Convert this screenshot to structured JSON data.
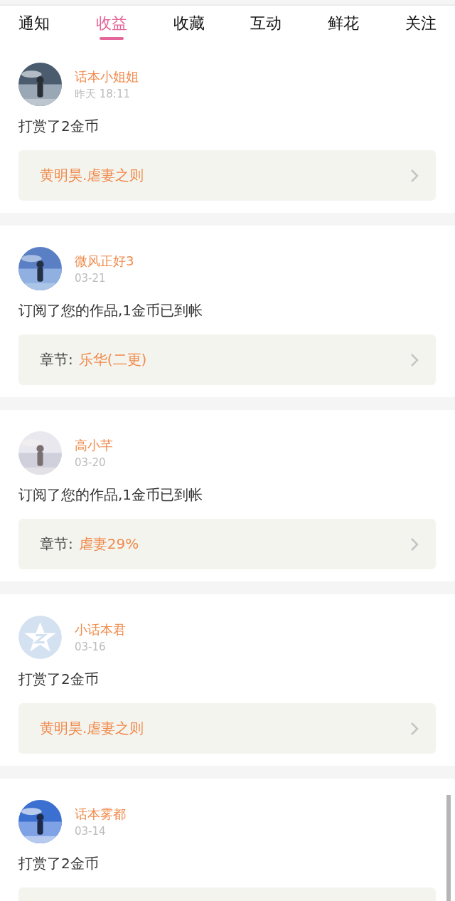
{
  "tabs": [
    {
      "label": "通知",
      "selected": false
    },
    {
      "label": "收益",
      "selected": true
    },
    {
      "label": "收藏",
      "selected": false
    },
    {
      "label": "互动",
      "selected": false
    },
    {
      "label": "鲜花",
      "selected": false
    },
    {
      "label": "关注",
      "selected": false
    }
  ],
  "entries": [
    {
      "name": "话本小姐姐",
      "time": "昨天 18:11",
      "message": "打赏了2金币",
      "link": {
        "kind": "work",
        "title": "黄明昊.虐妻之则"
      }
    },
    {
      "name": "微风正好3",
      "time": "03-21",
      "message": "订阅了您的作品,1金币已到帐",
      "link": {
        "kind": "chapter",
        "label": "章节:",
        "title": "乐华(二更)"
      }
    },
    {
      "name": "高小芊",
      "time": "03-20",
      "message": "订阅了您的作品,1金币已到帐",
      "link": {
        "kind": "chapter",
        "label": "章节:",
        "title": "虐妻29%"
      }
    },
    {
      "avatar": {
        "kind": "default"
      },
      "name": "小话本君",
      "time": "03-16",
      "message": "打赏了2金币",
      "link": {
        "kind": "work",
        "title": "黄明昊.虐妻之则"
      }
    },
    {
      "name": "话本雾都",
      "time": "03-14",
      "message": "打赏了2金币",
      "link": {
        "kind": "blank"
      }
    }
  ]
}
